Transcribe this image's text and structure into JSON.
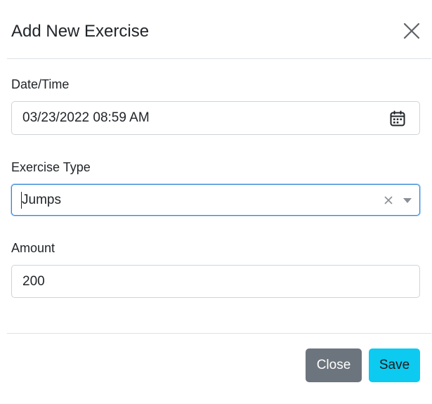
{
  "modal": {
    "title": "Add New Exercise",
    "close_icon": "close-x-icon"
  },
  "form": {
    "datetime": {
      "label": "Date/Time",
      "value": "03/23/2022 08:59  AM",
      "icon": "calendar-icon"
    },
    "exercise_type": {
      "label": "Exercise Type",
      "value": "Jumps",
      "clear_icon": "clear-x-icon",
      "dropdown_icon": "chevron-down-icon",
      "focus_color": "#2f86d6"
    },
    "amount": {
      "label": "Amount",
      "value": "200"
    }
  },
  "footer": {
    "close_label": "Close",
    "save_label": "Save",
    "close_color": "#6c757d",
    "save_color": "#0dcaf0"
  }
}
